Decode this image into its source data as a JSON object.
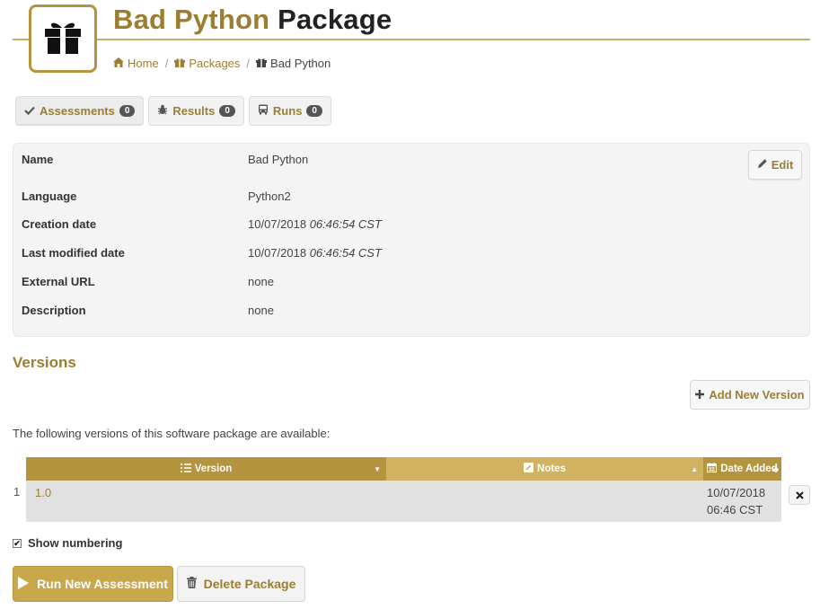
{
  "header": {
    "title_part1": "Bad Python",
    "title_part2": "Package"
  },
  "breadcrumb": {
    "home": "Home",
    "packages": "Packages",
    "current": "Bad Python"
  },
  "tabs": [
    {
      "label": "Assessments",
      "count": "0"
    },
    {
      "label": "Results",
      "count": "0"
    },
    {
      "label": "Runs",
      "count": "0"
    }
  ],
  "details": {
    "edit_label": "Edit",
    "rows": [
      {
        "label": "Name",
        "value": "Bad Python",
        "time": ""
      },
      {
        "label": "Language",
        "value": "Python2",
        "time": ""
      },
      {
        "label": "Creation date",
        "value": "10/07/2018",
        "time": "06:46:54 CST"
      },
      {
        "label": "Last modified date",
        "value": "10/07/2018",
        "time": "06:46:54 CST"
      },
      {
        "label": "External URL",
        "value": "none",
        "time": ""
      },
      {
        "label": "Description",
        "value": "none",
        "time": ""
      }
    ]
  },
  "versions": {
    "title": "Versions",
    "add_label": "Add New Version",
    "intro": "The following versions of this software package are available:",
    "columns": [
      "Version",
      "Notes",
      "Date Added"
    ],
    "rows": [
      {
        "number": "1",
        "version": "1.0",
        "notes": "",
        "date": "10/07/2018",
        "time": "06:46 CST"
      }
    ],
    "show_numbering_label": "Show numbering",
    "show_numbering": true
  },
  "actions": {
    "run_label": "Run New Assessment",
    "delete_label": "Delete Package"
  },
  "colors": {
    "accent": "#9c7d32",
    "header_gold": "#b5943f",
    "run_button": "#c9a74b"
  },
  "icons": {
    "page": "gift-icon",
    "home": "home-icon",
    "package": "gift-icon",
    "assessments": "check-icon",
    "results": "bug-icon",
    "runs": "bus-icon",
    "edit": "pencil-icon",
    "add": "plus-icon",
    "version_col": "list-icon",
    "notes_col": "edit-icon",
    "date_col": "calendar-icon",
    "run": "play-icon",
    "delete": "trash-icon",
    "remove_row": "close-icon"
  }
}
